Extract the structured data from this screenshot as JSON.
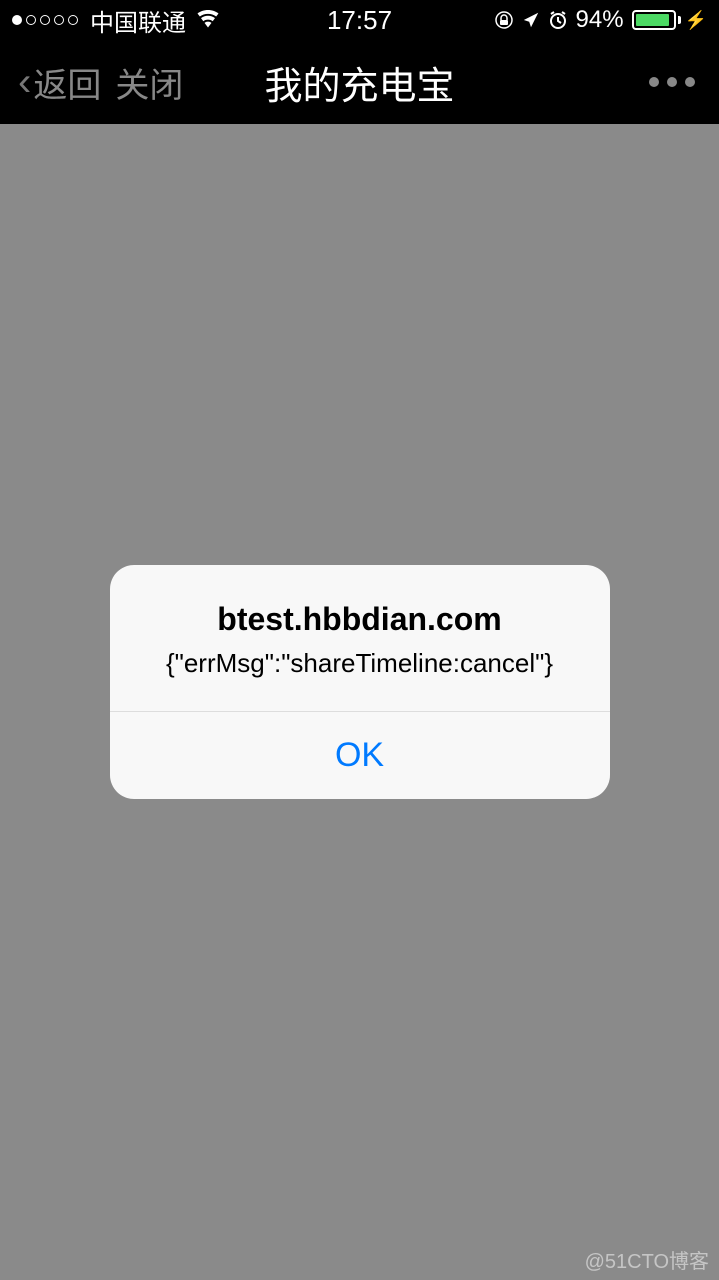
{
  "statusBar": {
    "carrier": "中国联通",
    "time": "17:57",
    "batteryPercent": "94%"
  },
  "navBar": {
    "back": "返回",
    "close": "关闭",
    "title": "我的充电宝"
  },
  "alert": {
    "title": "btest.hbbdian.com",
    "message": "{\"errMsg\":\"shareTimeline:cancel\"}",
    "okButton": "OK"
  },
  "watermark": "@51CTO博客"
}
